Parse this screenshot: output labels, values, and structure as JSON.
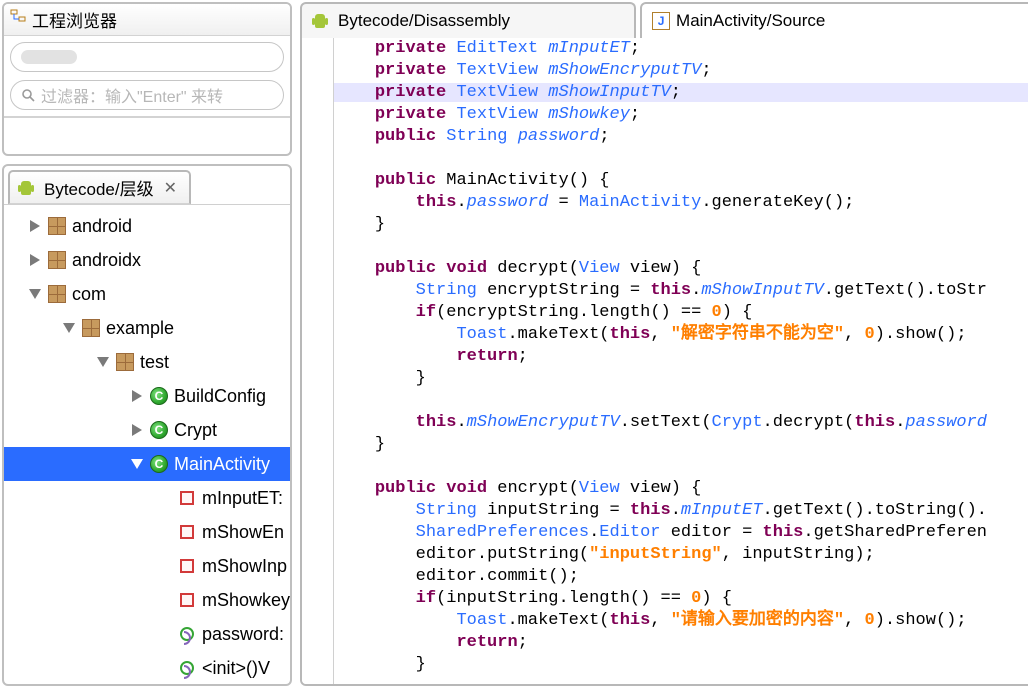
{
  "left": {
    "projectTitle": "工程浏览器",
    "filterPlaceholder": "过滤器：输入\"Enter\" 来转",
    "hierarchyTitle": "Bytecode/层级"
  },
  "tree": {
    "android": "android",
    "androidx": "androidx",
    "com": "com",
    "example": "example",
    "test": "test",
    "buildConfig": "BuildConfig",
    "crypt": "Crypt",
    "mainActivity": "MainActivity",
    "mInputET": "mInputET:",
    "mShowEn": "mShowEn",
    "mShowInp": "mShowInp",
    "mShowkey": "mShowkey",
    "password": "password:",
    "init": "<init>()V"
  },
  "tabs": {
    "disassembly": "Bytecode/Disassembly",
    "source": "MainActivity/Source"
  },
  "code": {
    "private": "private",
    "public": "public",
    "void": "void",
    "EditText": "EditText",
    "TextView": "TextView",
    "String": "String",
    "View": "View",
    "Toast": "Toast",
    "Crypt": "Crypt",
    "MainActivity": "MainActivity",
    "SharedPreferences": "SharedPreferences",
    "Editor": "Editor",
    "mInputET": "mInputET",
    "mShowEncryputTV": "mShowEncryputTV",
    "mShowInputTV": "mShowInputTV",
    "mShowkey": "mShowkey",
    "password": "password",
    "passwordIt": "password",
    "this": "this",
    "generateKey": "generateKey",
    "decrypt": "decrypt",
    "encrypt": "encrypt",
    "view": "view",
    "encryptString": "encryptString",
    "inputString": "inputString",
    "getText": "getText",
    "toStr": "toStr",
    "toString": "toString",
    "length": "length",
    "makeText": "makeText",
    "show": "show",
    "return": "return",
    "setText": "setText",
    "editor": "editor",
    "getSharedPreferen": "getSharedPreferen",
    "putString": "putString",
    "commit": "commit",
    "str1": "\"解密字符串不能为空\"",
    "str2": "\"inputString\"",
    "str3": "\"请输入要加密的内容\"",
    "zero": "0"
  }
}
